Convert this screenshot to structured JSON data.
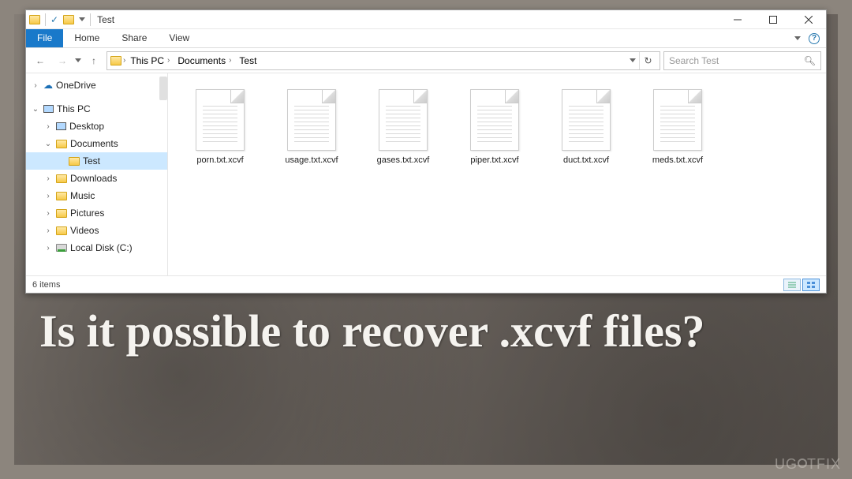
{
  "titlebar": {
    "title": "Test"
  },
  "ribbon": {
    "file": "File",
    "tabs": [
      "Home",
      "Share",
      "View"
    ]
  },
  "nav": {
    "breadcrumbs": [
      "This PC",
      "Documents",
      "Test"
    ],
    "search_placeholder": "Search Test"
  },
  "sidebar": {
    "items": [
      {
        "label": "OneDrive",
        "depth": 1,
        "expander": ">",
        "icon": "cloud"
      },
      {
        "label": "This PC",
        "depth": 1,
        "expander": "v",
        "icon": "pc"
      },
      {
        "label": "Desktop",
        "depth": 2,
        "expander": ">",
        "icon": "monitor"
      },
      {
        "label": "Documents",
        "depth": 2,
        "expander": "v",
        "icon": "doc"
      },
      {
        "label": "Test",
        "depth": 3,
        "expander": "",
        "icon": "folder",
        "selected": true
      },
      {
        "label": "Downloads",
        "depth": 2,
        "expander": ">",
        "icon": "down"
      },
      {
        "label": "Music",
        "depth": 2,
        "expander": ">",
        "icon": "music"
      },
      {
        "label": "Pictures",
        "depth": 2,
        "expander": ">",
        "icon": "pic"
      },
      {
        "label": "Videos",
        "depth": 2,
        "expander": ">",
        "icon": "vid"
      },
      {
        "label": "Local Disk (C:)",
        "depth": 2,
        "expander": ">",
        "icon": "disk"
      }
    ]
  },
  "files": [
    {
      "name": "porn.txt.xcvf"
    },
    {
      "name": "usage.txt.xcvf"
    },
    {
      "name": "gases.txt.xcvf"
    },
    {
      "name": "piper.txt.xcvf"
    },
    {
      "name": "duct.txt.xcvf"
    },
    {
      "name": "meds.txt.xcvf"
    }
  ],
  "statusbar": {
    "count": "6 items"
  },
  "caption": "Is it possible to recover .xcvf files?",
  "watermark": "UG TFIX"
}
